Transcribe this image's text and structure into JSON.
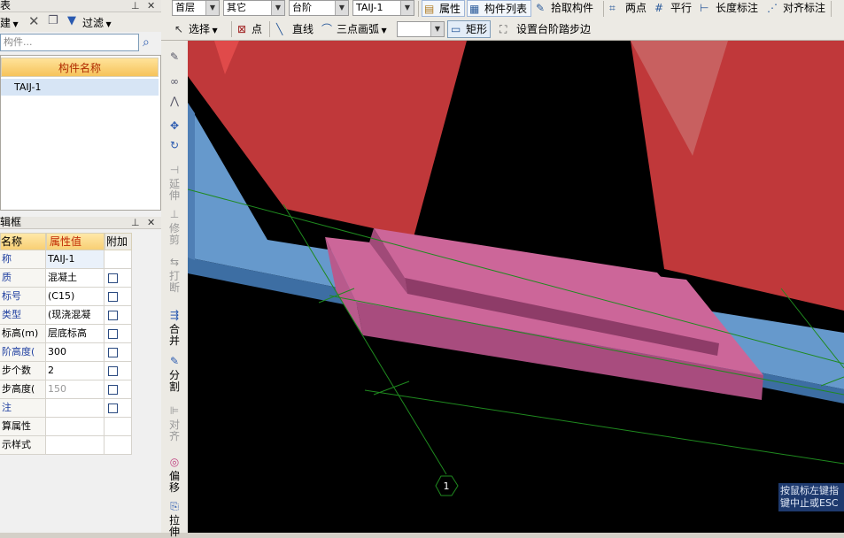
{
  "left_panel": {
    "list_title": "表",
    "new_button": "建",
    "filter_button": "过滤",
    "search_placeholder": "构件...",
    "list_header": "构件名称",
    "list_items": [
      "TAIJ-1"
    ],
    "props_title": "辑框",
    "props_headers": [
      "名称",
      "属性值",
      "附加"
    ],
    "props_rows": [
      {
        "name": "称",
        "value": "TAIJ-1",
        "check": false
      },
      {
        "name": "质",
        "value": "混凝土",
        "check": true
      },
      {
        "name": "标号",
        "value": "(C15)",
        "check": true
      },
      {
        "name": "类型",
        "value": "(现浇混凝",
        "check": true
      },
      {
        "name": "标高(m)",
        "value": "层底标高",
        "check": true
      },
      {
        "name": "阶高度(",
        "value": "300",
        "check": true
      },
      {
        "name": "步个数",
        "value": "2",
        "check": true
      },
      {
        "name": "步高度(",
        "value": "150",
        "check": true
      },
      {
        "name": "注",
        "value": "",
        "check": true
      },
      {
        "name": "算属性",
        "value": "",
        "check": false
      },
      {
        "name": "示样式",
        "value": "",
        "check": false
      }
    ]
  },
  "toolbar_top": {
    "floor": "首层",
    "category": "其它",
    "type": "台阶",
    "component": "TAIJ-1",
    "property_btn": "属性",
    "component_list_btn": "构件列表",
    "pick_btn": "拾取构件",
    "two_points_btn": "两点",
    "parallel_btn": "平行",
    "length_dim_btn": "长度标注",
    "align_dim_btn": "对齐标注"
  },
  "toolbar_draw": {
    "select_btn": "选择",
    "point_btn": "点",
    "line_btn": "直线",
    "arc_btn": "三点画弧",
    "rect_btn": "矩形",
    "step_edge_btn": "设置台阶踏步边"
  },
  "vertical_tools": [
    "延伸",
    "修剪",
    "打断",
    "合并",
    "分割",
    "对齐",
    "偏移",
    "拉伸"
  ],
  "canvas": {
    "axis_label": "1",
    "status_text": [
      "按鼠标左键指",
      "键中止或ESC"
    ]
  },
  "colors": {
    "wall_red": "#c0383a",
    "slab_blue": "#6699cc",
    "step_pink": "#cc6699",
    "axis_green": "#1f8a1f",
    "canvas_bg": "#000000"
  }
}
